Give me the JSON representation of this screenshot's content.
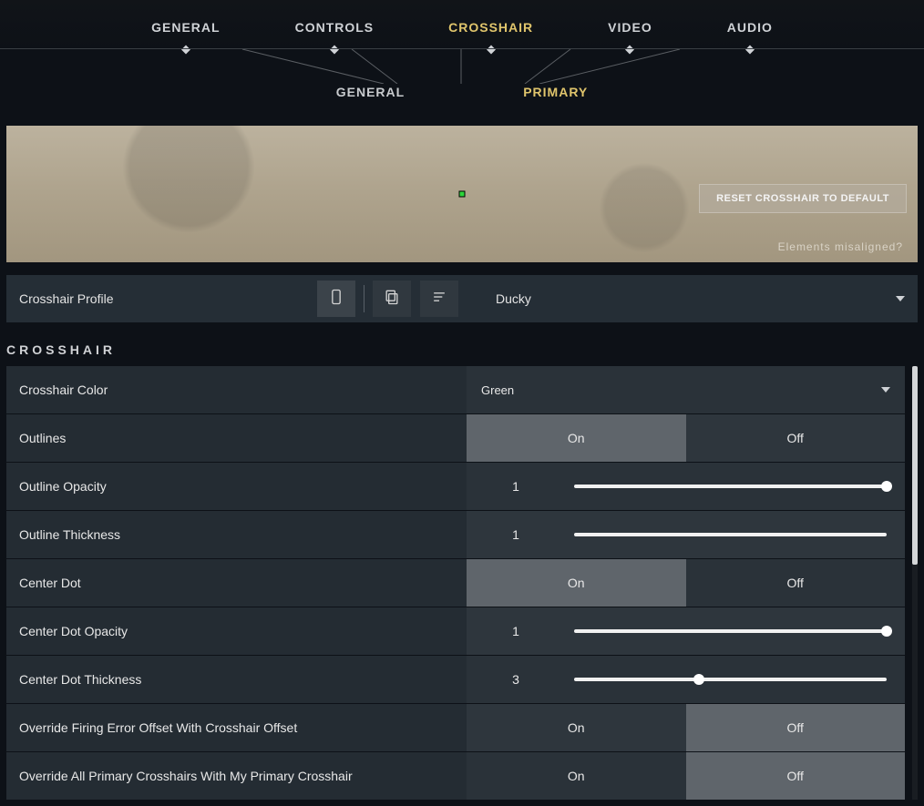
{
  "nav": {
    "tabs": [
      {
        "label": "GENERAL"
      },
      {
        "label": "CONTROLS"
      },
      {
        "label": "CROSSHAIR"
      },
      {
        "label": "VIDEO"
      },
      {
        "label": "AUDIO"
      }
    ],
    "active_index": 2
  },
  "subnav": {
    "tabs": [
      {
        "label": "GENERAL"
      },
      {
        "label": "PRIMARY"
      }
    ],
    "active_index": 1
  },
  "preview": {
    "reset_label": "RESET CROSSHAIR TO DEFAULT",
    "misaligned_label": "Elements misaligned?"
  },
  "profile": {
    "label": "Crosshair Profile",
    "selected": "Ducky",
    "icons": [
      "phone-icon",
      "copy-icon",
      "list-icon"
    ]
  },
  "section_title": "CROSSHAIR",
  "toggle_labels": {
    "on": "On",
    "off": "Off"
  },
  "settings": [
    {
      "type": "dropdown",
      "label": "Crosshair Color",
      "value": "Green"
    },
    {
      "type": "toggle",
      "label": "Outlines",
      "value": "On"
    },
    {
      "type": "slider",
      "label": "Outline Opacity",
      "value": "1",
      "percent": 100
    },
    {
      "type": "slider",
      "label": "Outline Thickness",
      "value": "1",
      "percent": 100,
      "thumb_hidden": true
    },
    {
      "type": "toggle",
      "label": "Center Dot",
      "value": "On"
    },
    {
      "type": "slider",
      "label": "Center Dot Opacity",
      "value": "1",
      "percent": 100
    },
    {
      "type": "slider",
      "label": "Center Dot Thickness",
      "value": "3",
      "percent": 40
    },
    {
      "type": "toggle",
      "label": "Override Firing Error Offset With Crosshair Offset",
      "value": "Off"
    },
    {
      "type": "toggle",
      "label": "Override All Primary Crosshairs With My Primary Crosshair",
      "value": "Off"
    }
  ]
}
